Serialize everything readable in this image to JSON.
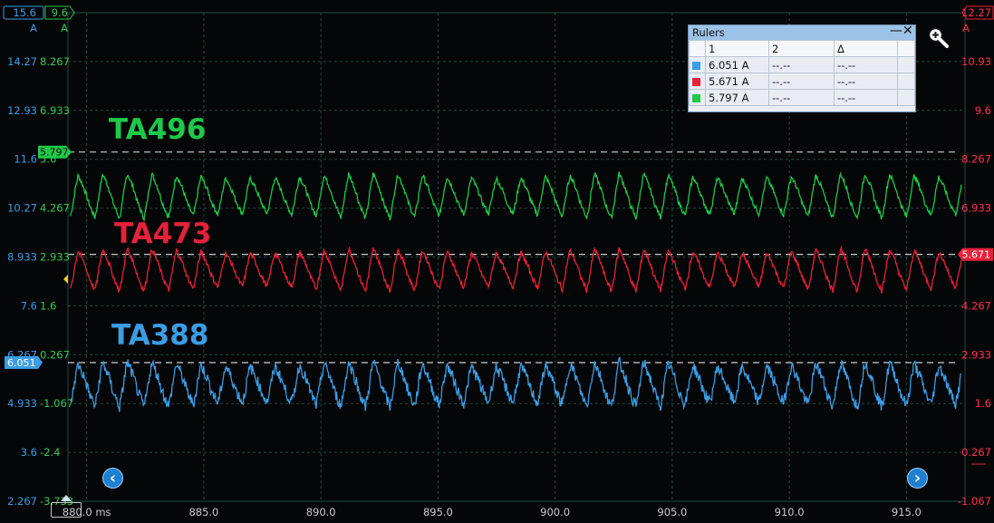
{
  "colors": {
    "background": "#050607",
    "grid": "#1f4a46",
    "blue": "#3b9de4",
    "red": "#e8213a",
    "green": "#1ec94a",
    "text_red": "#ff3050",
    "text_blue": "#3b9de4",
    "text_green": "#33cc55"
  },
  "axis_headers": {
    "blue_top": "15.6",
    "blue_unit": "A",
    "green_top": "9.6",
    "green_unit": "A",
    "red_top": "12.27",
    "red_unit": "A"
  },
  "chart_data": {
    "type": "line",
    "x_unit": "ms",
    "x_ticks": [
      "880.0 ms",
      "885.0",
      "890.0",
      "895.0",
      "900.0",
      "905.0",
      "910.0",
      "915.0"
    ],
    "x_tick_values": [
      880,
      885,
      890,
      895,
      900,
      905,
      910,
      915
    ],
    "x_range": [
      879.2,
      917.5
    ],
    "grid": true,
    "axes": {
      "blue_left": {
        "range": [
          2.267,
          15.6
        ],
        "ticks": [
          "14.27",
          "12.93",
          "11.6",
          "10.27",
          "8.933",
          "7.6",
          "6.267",
          "4.933",
          "3.6",
          "2.267"
        ]
      },
      "green_left": {
        "range": [
          -3.733,
          9.6
        ],
        "ticks": [
          "8.267",
          "6.933",
          "5.6",
          "4.267",
          "2.933",
          "1.6",
          "0.267",
          "-1.067",
          "-2.4",
          "-3.733"
        ]
      },
      "red_right": {
        "range": [
          -1.067,
          12.27
        ],
        "ticks": [
          "10.93",
          "9.6",
          "8.267",
          "6.933",
          "5.6",
          "4.267",
          "2.933",
          "1.6",
          "0.267",
          "-1.067"
        ]
      }
    },
    "series": [
      {
        "name": "TA496",
        "color": "green",
        "axis": "green_left",
        "center": 4.6,
        "amplitude": 0.55,
        "ruler": 5.797
      },
      {
        "name": "TA473",
        "color": "red",
        "axis": "red_right",
        "center": 5.25,
        "amplitude": 0.52,
        "ruler": 5.671
      },
      {
        "name": "TA388",
        "color": "blue",
        "axis": "blue_left",
        "center": 5.45,
        "amplitude": 0.55,
        "ruler": 6.051
      }
    ],
    "period_ms": 1.05
  },
  "trace_labels": {
    "green": "TA496",
    "red": "TA473",
    "blue": "TA388"
  },
  "ruler_tags": {
    "green": "5.797",
    "red": "5.671",
    "blue": "6.051"
  },
  "rulers_panel": {
    "title": "Rulers",
    "minimize": "—",
    "close": "✕",
    "headers": [
      "",
      "1",
      "2",
      "Δ"
    ],
    "rows": [
      {
        "swatch": "#3b9de4",
        "c1": "6.051 A",
        "c2": "--.--",
        "delta": "--.--"
      },
      {
        "swatch": "#e8213a",
        "c1": "5.671 A",
        "c2": "--.--",
        "delta": "--.--"
      },
      {
        "swatch": "#1ec94a",
        "c1": "5.797 A",
        "c2": "--.--",
        "delta": "--.--"
      }
    ]
  },
  "nav": {
    "left": "‹",
    "right": "›"
  },
  "icons": {
    "zoom": "zoom-in-icon"
  }
}
